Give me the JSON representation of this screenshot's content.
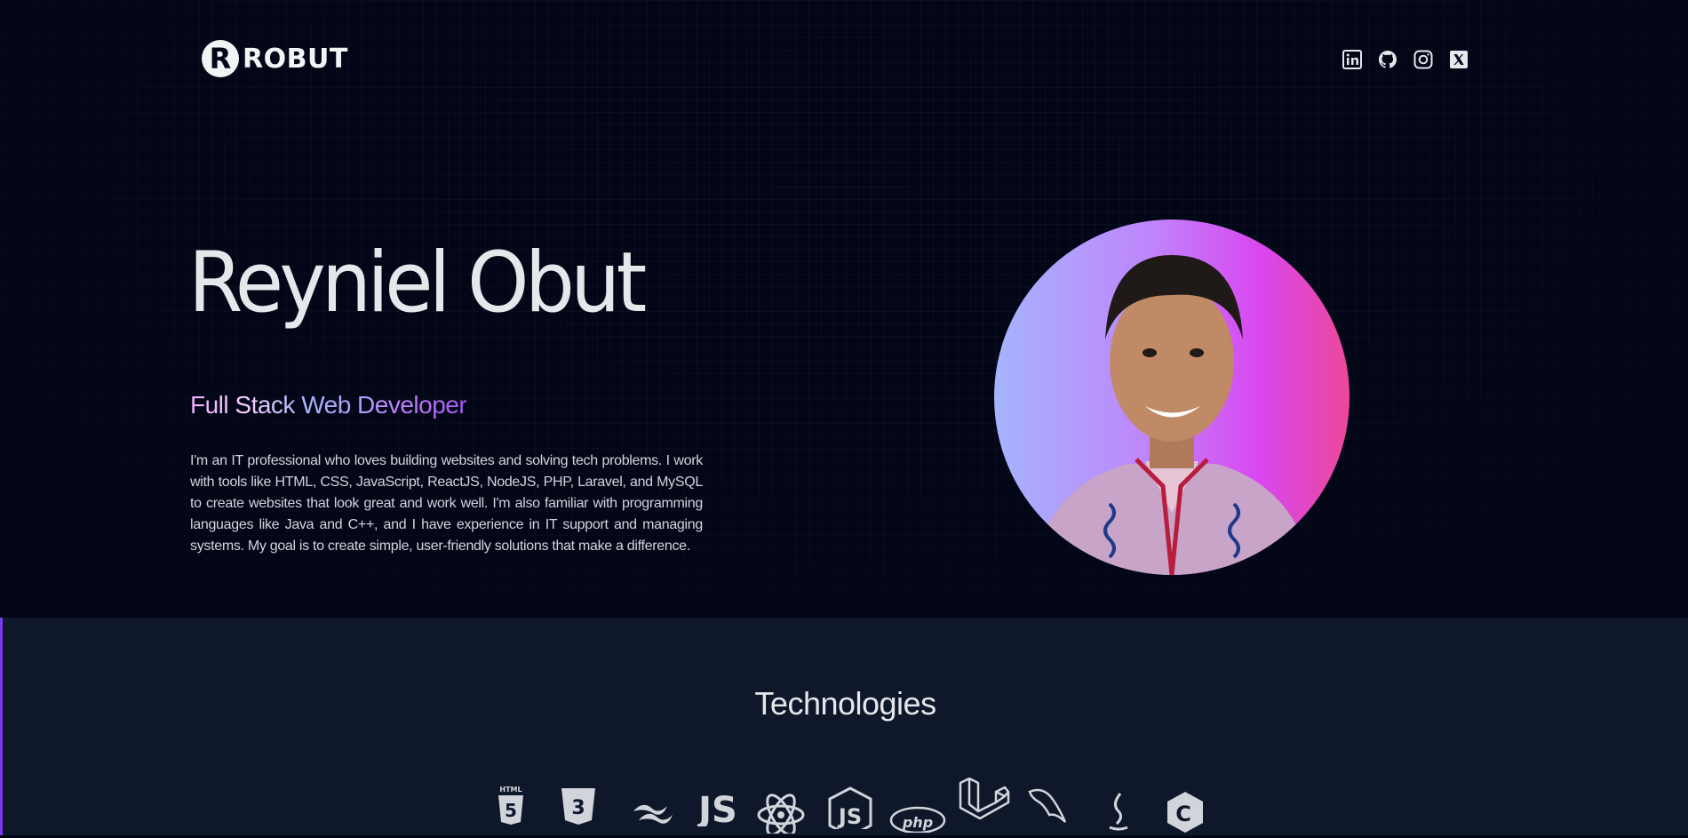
{
  "header": {
    "logo_mark": "R",
    "logo_text": "ROBUT",
    "socials": [
      {
        "name": "linkedin",
        "icon": "linkedin-icon"
      },
      {
        "name": "github",
        "icon": "github-icon"
      },
      {
        "name": "instagram",
        "icon": "instagram-icon"
      },
      {
        "name": "x",
        "icon": "x-icon"
      }
    ]
  },
  "hero": {
    "name": "Reyniel Obut",
    "role": "Full Stack Web Developer",
    "bio": "I'm an IT professional who loves building websites and solving tech problems. I work with tools like HTML, CSS, JavaScript, ReactJS, NodeJS, PHP, Laravel, and MySQL to create websites that look great and work well. I'm also familiar with programming languages like Java and C++, and I have experience in IT support and managing systems. My goal is to create simple, user-friendly solutions that make a difference.",
    "avatar_gradient": [
      "#a5b4fc",
      "#c084fc",
      "#d946ef",
      "#ec4899"
    ]
  },
  "technologies": {
    "title": "Technologies",
    "icons": [
      "html5-icon",
      "css3-icon",
      "tailwind-icon",
      "javascript-icon",
      "react-icon",
      "nodejs-icon",
      "php-icon",
      "laravel-icon",
      "mysql-icon",
      "java-icon",
      "cplusplus-icon"
    ]
  },
  "colors": {
    "background": "#030617",
    "section_background": "#0f172a",
    "accent": "#7c3aed"
  }
}
